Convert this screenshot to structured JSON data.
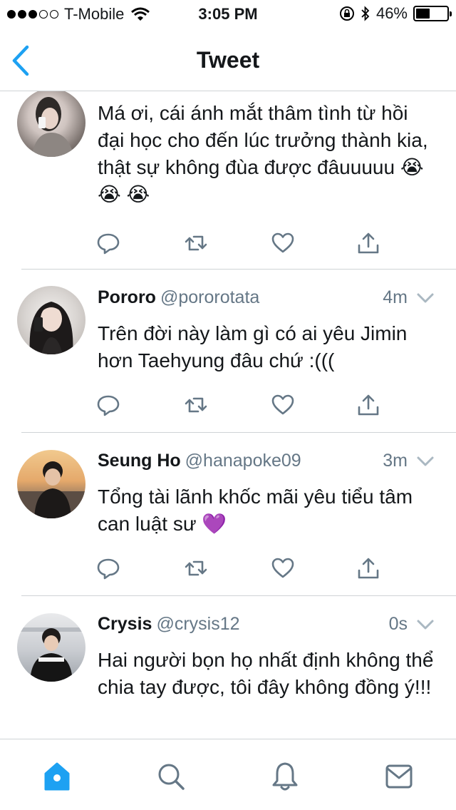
{
  "status_bar": {
    "carrier": "T-Mobile",
    "time": "3:05 PM",
    "battery_text": "46%",
    "battery_level": 0.46,
    "signal_bars": 2
  },
  "nav": {
    "title": "Tweet",
    "back_icon": "chevron-left-icon"
  },
  "tweets": [
    {
      "name": "",
      "handle": "",
      "time": "",
      "text": "Má ơi, cái ánh mắt thâm tình từ hồi đại học cho đến lúc trưởng thành kia, thật sự không đùa được đâuuuuu 😭 😭 😭"
    },
    {
      "name": "Pororo",
      "handle": "@pororotata",
      "time": "4m",
      "text": "Trên đời này làm gì có ai yêu Jimin hơn Taehyung đâu chứ :((("
    },
    {
      "name": "Seung Ho",
      "handle": "@hanapoke09",
      "time": "3m",
      "text": "Tổng tài lãnh khốc mãi yêu tiểu tâm can luật sư 💜"
    },
    {
      "name": "Crysis",
      "handle": "@crysis12",
      "time": "0s",
      "text": "Hai người bọn họ nhất định không thể chia tay được, tôi đây không đồng ý!!!"
    }
  ],
  "tweet_actions": [
    "reply-icon",
    "retweet-icon",
    "like-icon",
    "share-icon"
  ],
  "tab_bar": [
    "home-icon",
    "search-icon",
    "notifications-icon",
    "messages-icon"
  ],
  "colors": {
    "accent": "#1da1f2",
    "icon_gray": "#657786",
    "divider": "#cfd3d6",
    "text": "#14171a"
  }
}
